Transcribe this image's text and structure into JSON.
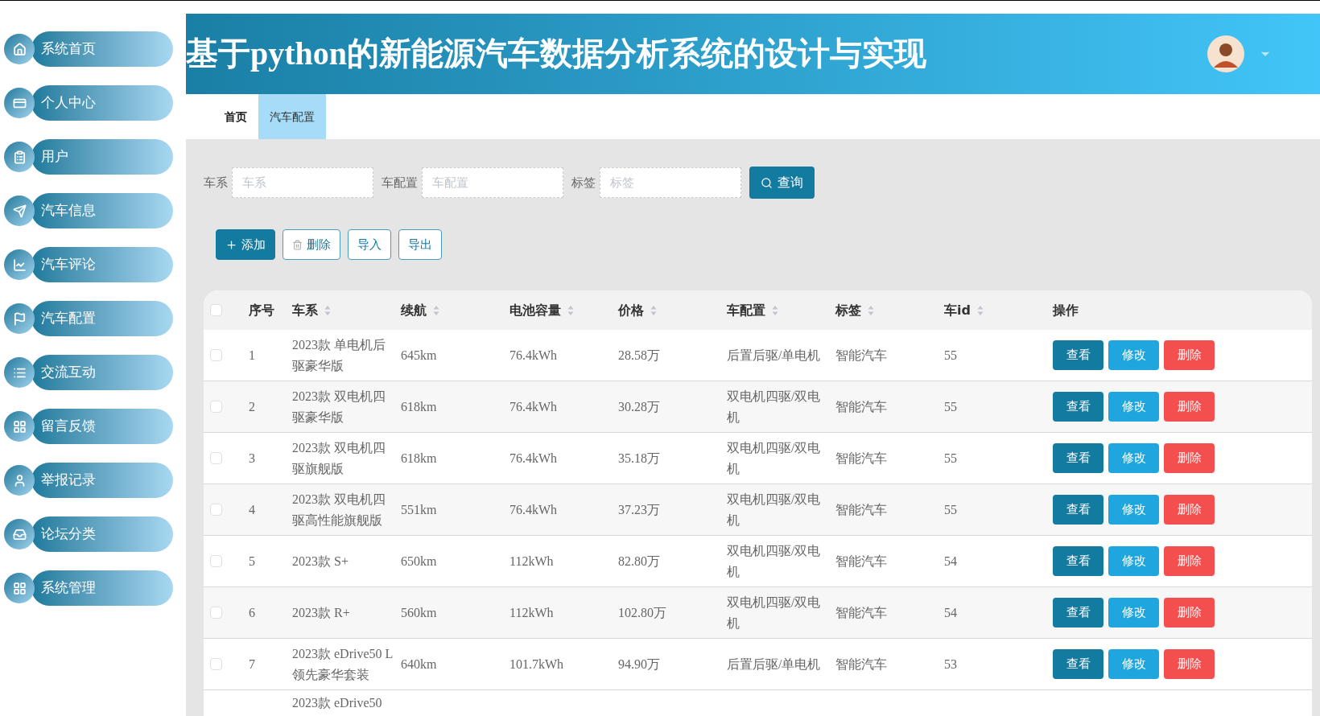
{
  "sidebar": {
    "items": [
      {
        "label": "系统首页"
      },
      {
        "label": "个人中心"
      },
      {
        "label": "用户"
      },
      {
        "label": "汽车信息"
      },
      {
        "label": "汽车评论"
      },
      {
        "label": "汽车配置"
      },
      {
        "label": "交流互动"
      },
      {
        "label": "留言反馈"
      },
      {
        "label": "举报记录"
      },
      {
        "label": "论坛分类"
      },
      {
        "label": "系统管理"
      }
    ]
  },
  "header": {
    "title": "基于python的新能源汽车数据分析系统的设计与实现"
  },
  "tabs": [
    {
      "label": "首页",
      "selected": false
    },
    {
      "label": "汽车配置",
      "selected": true
    }
  ],
  "search": {
    "fields": [
      {
        "label": "车系",
        "placeholder": "车系"
      },
      {
        "label": "车配置",
        "placeholder": "车配置"
      },
      {
        "label": "标签",
        "placeholder": "标签"
      }
    ],
    "button": "查询"
  },
  "toolbar": [
    {
      "label": "添加",
      "kind": "add"
    },
    {
      "label": "删除",
      "kind": "delete"
    },
    {
      "label": "导入",
      "kind": "plain"
    },
    {
      "label": "导出",
      "kind": "plain"
    }
  ],
  "table": {
    "header_checked": false,
    "columns": [
      {
        "label": "序号",
        "sortable": false
      },
      {
        "label": "车系",
        "sortable": true
      },
      {
        "label": "续航",
        "sortable": true
      },
      {
        "label": "电池容量",
        "sortable": true
      },
      {
        "label": "价格",
        "sortable": true
      },
      {
        "label": "车配置",
        "sortable": true
      },
      {
        "label": "标签",
        "sortable": true
      },
      {
        "label": "车id",
        "sortable": true
      },
      {
        "label": "操作",
        "sortable": false
      }
    ],
    "rows": [
      {
        "checked": false,
        "cells": [
          "1",
          "2023款 单电机后驱豪华版",
          "645km",
          "76.4kWh",
          "28.58万",
          "后置后驱/单电机",
          "智能汽车",
          "55"
        ],
        "actions": [
          "查看",
          "修改",
          "删除"
        ]
      },
      {
        "checked": false,
        "cells": [
          "2",
          "2023款 双电机四驱豪华版",
          "618km",
          "76.4kWh",
          "30.28万",
          "双电机四驱/双电机",
          "智能汽车",
          "55"
        ],
        "actions": [
          "查看",
          "修改",
          "删除"
        ]
      },
      {
        "checked": false,
        "cells": [
          "3",
          "2023款 双电机四驱旗舰版",
          "618km",
          "76.4kWh",
          "35.18万",
          "双电机四驱/双电机",
          "智能汽车",
          "55"
        ],
        "actions": [
          "查看",
          "修改",
          "删除"
        ]
      },
      {
        "checked": false,
        "cells": [
          "4",
          "2023款 双电机四驱高性能旗舰版",
          "551km",
          "76.4kWh",
          "37.23万",
          "双电机四驱/双电机",
          "智能汽车",
          "55"
        ],
        "actions": [
          "查看",
          "修改",
          "删除"
        ]
      },
      {
        "checked": false,
        "cells": [
          "5",
          "2023款 S+",
          "650km",
          "112kWh",
          "82.80万",
          "双电机四驱/双电机",
          "智能汽车",
          "54"
        ],
        "actions": [
          "查看",
          "修改",
          "删除"
        ]
      },
      {
        "checked": false,
        "cells": [
          "6",
          "2023款 R+",
          "560km",
          "112kWh",
          "102.80万",
          "双电机四驱/双电机",
          "智能汽车",
          "54"
        ],
        "actions": [
          "查看",
          "修改",
          "删除"
        ]
      },
      {
        "checked": false,
        "cells": [
          "7",
          "2023款 eDrive50 L 领先豪华套装",
          "640km",
          "101.7kWh",
          "94.90万",
          "后置后驱/单电机",
          "智能汽车",
          "53"
        ],
        "actions": [
          "查看",
          "修改",
          "删除"
        ]
      }
    ],
    "partial_row": "2023款 eDrive50"
  }
}
